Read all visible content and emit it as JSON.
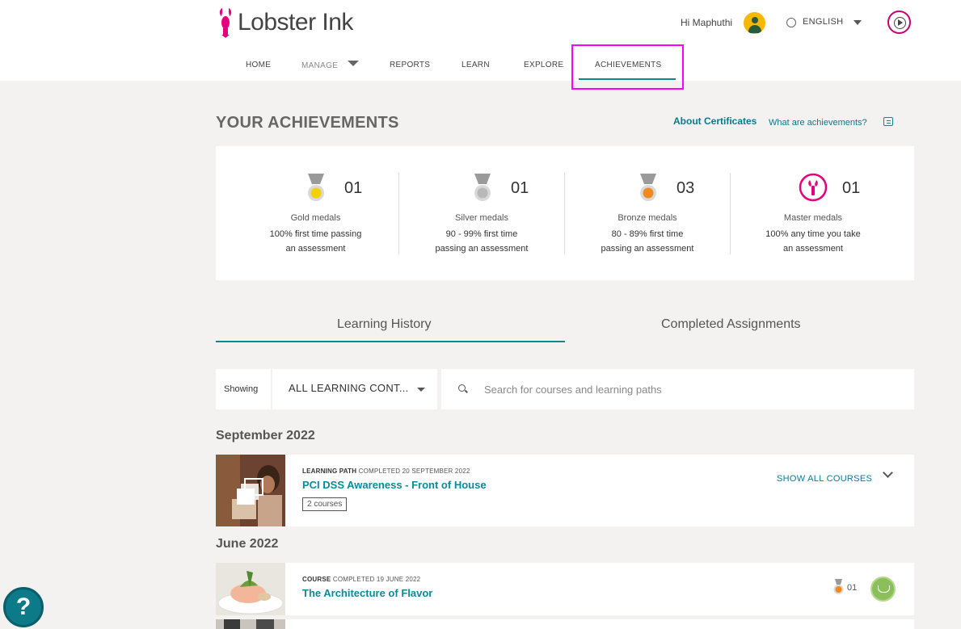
{
  "app": {
    "logo_text": "Lobster Ink",
    "greeting": "Hi Maphuthi",
    "language": "ENGLISH"
  },
  "nav": {
    "items": [
      "HOME",
      "MANAGE",
      "REPORTS",
      "LEARN",
      "EXPLORE",
      "ACHIEVEMENTS"
    ],
    "active": "ACHIEVEMENTS"
  },
  "achievements": {
    "title": "YOUR ACHIEVEMENTS",
    "about_link": "About Certificates",
    "what_link": "What are achievements?",
    "medals": [
      {
        "name": "Gold medals",
        "count": "01",
        "desc": "100% first time passing an assessment",
        "color": "#f5d000"
      },
      {
        "name": "Silver medals",
        "count": "01",
        "desc": "90 - 99% first time passing an assessment",
        "color": "#b8b8b8"
      },
      {
        "name": "Bronze medals",
        "count": "03",
        "desc": "80 - 89% first time passing an assessment",
        "color": "#f08a1c"
      },
      {
        "name": "Master medals",
        "count": "01",
        "desc": "100% any time you take an assessment",
        "color": "#e6007e"
      }
    ]
  },
  "tabs": {
    "learning_history": "Learning History",
    "completed_assignments": "Completed Assignments"
  },
  "filter": {
    "showing_label": "Showing",
    "selected": "ALL LEARNING CONT...",
    "search_placeholder": "Search for courses and learning paths"
  },
  "history": {
    "groups": [
      {
        "month": "September 2022",
        "items": [
          {
            "kind": "LEARNING PATH",
            "completed": "COMPLETED 20 SEPTEMBER 2022",
            "title": "PCI DSS Awareness - Front of House",
            "badge": "2 courses",
            "action": "SHOW ALL COURSES"
          }
        ]
      },
      {
        "month": "June 2022",
        "items": [
          {
            "kind": "COURSE",
            "completed": "COMPLETED 19 JUNE 2022",
            "title": "The Architecture of Flavor",
            "medal_count": "01"
          }
        ]
      }
    ]
  },
  "help": {
    "label": "?"
  }
}
